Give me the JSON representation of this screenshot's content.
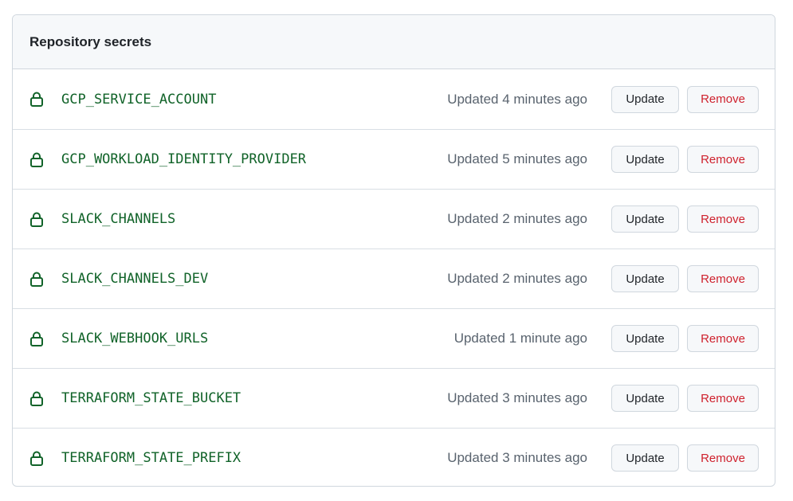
{
  "header": {
    "title": "Repository secrets"
  },
  "secrets": [
    {
      "name": "GCP_SERVICE_ACCOUNT",
      "updated": "Updated 4 minutes ago"
    },
    {
      "name": "GCP_WORKLOAD_IDENTITY_PROVIDER",
      "updated": "Updated 5 minutes ago"
    },
    {
      "name": "SLACK_CHANNELS",
      "updated": "Updated 2 minutes ago"
    },
    {
      "name": "SLACK_CHANNELS_DEV",
      "updated": "Updated 2 minutes ago"
    },
    {
      "name": "SLACK_WEBHOOK_URLS",
      "updated": "Updated 1 minute ago"
    },
    {
      "name": "TERRAFORM_STATE_BUCKET",
      "updated": "Updated 3 minutes ago"
    },
    {
      "name": "TERRAFORM_STATE_PREFIX",
      "updated": "Updated 3 minutes ago"
    }
  ],
  "actions": {
    "update_label": "Update",
    "remove_label": "Remove"
  },
  "icons": {
    "secret_icon": "lock-icon"
  },
  "colors": {
    "secret_name": "#116329",
    "remove_text": "#cf222e",
    "header_bg": "#f6f8fa",
    "border": "#d0d7de"
  }
}
